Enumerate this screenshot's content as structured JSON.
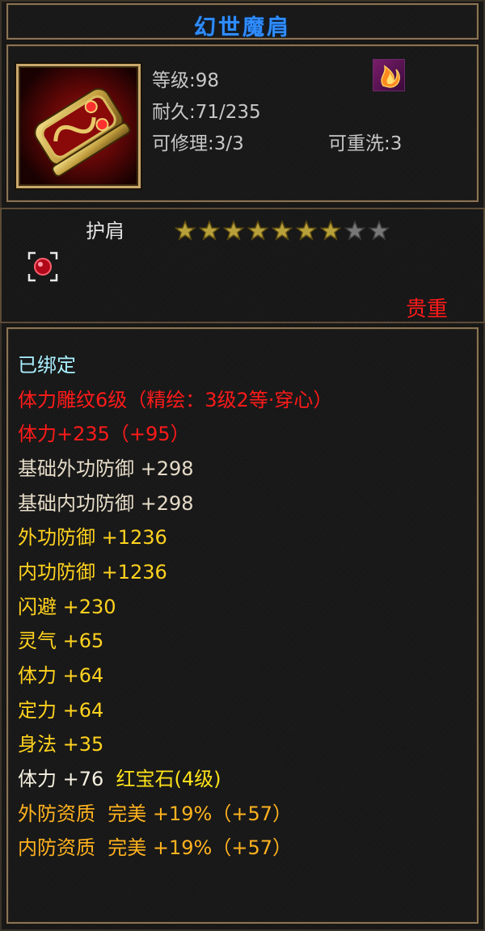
{
  "item": {
    "name": "幻世魔肩",
    "level_text": "等级:98",
    "durability_text": "耐久:71/235",
    "repair_text": "可修理:3/3",
    "reroll_text": "可重洗:3",
    "type": "护肩",
    "stars_total": 9,
    "stars_filled": 7,
    "rarity": "贵重"
  },
  "stats": [
    {
      "text": "已绑定",
      "color": "cyan"
    },
    {
      "text": "体力雕纹6级（精绘：3级2等·穿心）",
      "color": "red"
    },
    {
      "text": "体力+235（+95）",
      "color": "red"
    },
    {
      "text": "基础外功防御 +298",
      "color": "white"
    },
    {
      "text": "基础内功防御 +298",
      "color": "white"
    },
    {
      "text": "外功防御 +1236",
      "color": "yellow"
    },
    {
      "text": "内功防御 +1236",
      "color": "yellow"
    },
    {
      "text": "闪避 +230",
      "color": "yellow"
    },
    {
      "text": "灵气 +65",
      "color": "yellow"
    },
    {
      "text": "体力 +64",
      "color": "yellow"
    },
    {
      "text": "定力 +64",
      "color": "yellow"
    },
    {
      "text": "身法 +35",
      "color": "yellow"
    }
  ],
  "gem_line": {
    "stat": "体力 +76",
    "gem": "红宝石(4级)"
  },
  "quality_lines": [
    "外防资质  完美 +19%（+57）",
    "内防资质  完美 +19%（+57）"
  ],
  "icons": {
    "item": "gold-red-shoulder-guard-icon",
    "set": "flame-set-icon",
    "socket": "red-gem-socket-icon",
    "star": "star-icon"
  },
  "colors": {
    "title": "#2f8dff",
    "red": "#ff1a1a",
    "yellow": "#ffd21f",
    "orange": "#ffb21f",
    "cyan": "#aaf0ff",
    "star_filled": "#b8a03a",
    "star_empty": "#777777"
  }
}
